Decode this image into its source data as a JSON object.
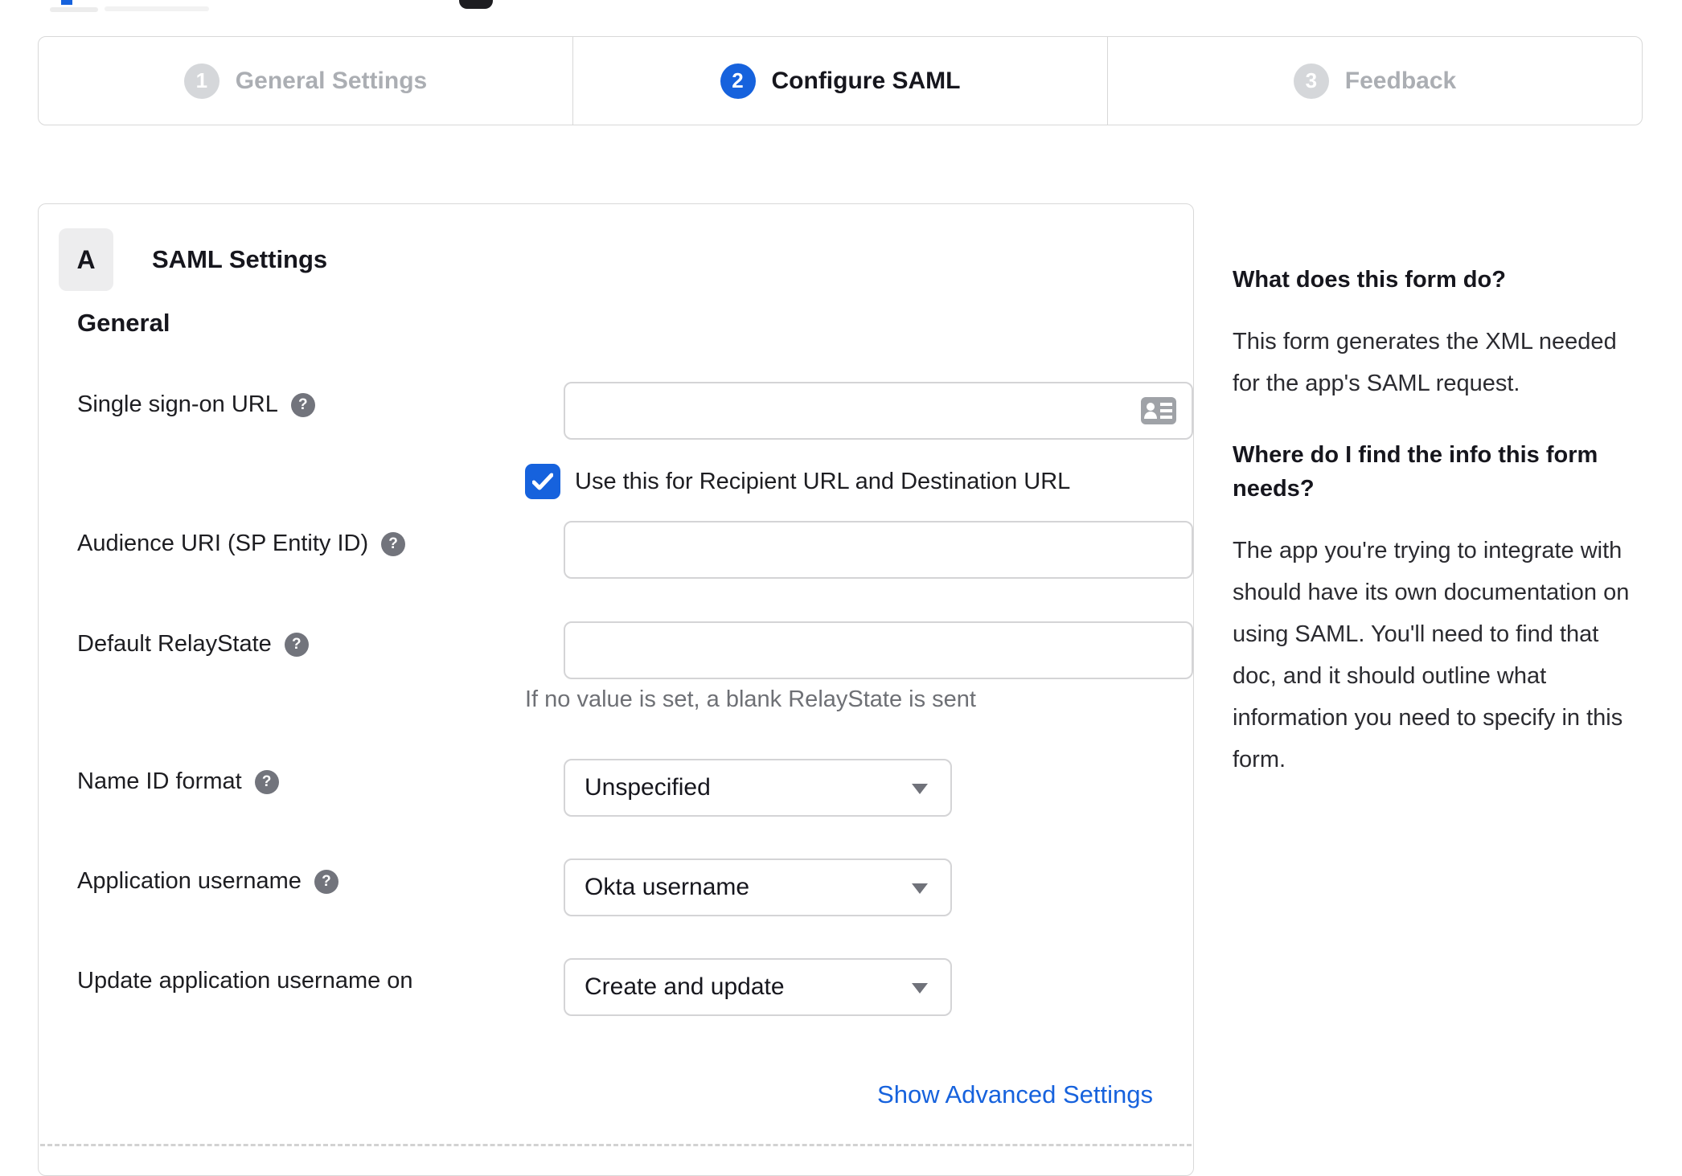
{
  "colors": {
    "accent_blue": "#1662dd",
    "inactive_grey": "#d5d7da",
    "border_grey": "#d8d8d8",
    "hint_grey": "#6e7075"
  },
  "stepper": {
    "steps": [
      {
        "number": "1",
        "label": "General Settings",
        "state": "inactive"
      },
      {
        "number": "2",
        "label": "Configure SAML",
        "state": "active"
      },
      {
        "number": "3",
        "label": "Feedback",
        "state": "inactive"
      }
    ]
  },
  "panel": {
    "section_badge": "A",
    "section_title": "SAML Settings",
    "group_heading": "General",
    "fields": [
      {
        "label": "Single sign-on URL",
        "has_help": true,
        "type": "text",
        "value": "",
        "icon": "contact-card-icon"
      },
      {
        "label": "Audience URI (SP Entity ID)",
        "has_help": true,
        "type": "text",
        "value": ""
      },
      {
        "label": "Default RelayState",
        "has_help": true,
        "type": "text",
        "value": "",
        "hint": "If no value is set, a blank RelayState is sent"
      },
      {
        "label": "Name ID format",
        "has_help": true,
        "type": "select",
        "value": "Unspecified"
      },
      {
        "label": "Application username",
        "has_help": true,
        "type": "select",
        "value": "Okta username"
      },
      {
        "label": "Update application username on",
        "has_help": false,
        "type": "select",
        "value": "Create and update"
      }
    ],
    "checkbox": {
      "checked": true,
      "label": "Use this for Recipient URL and Destination URL"
    },
    "advanced_link": "Show Advanced Settings"
  },
  "sidebar": {
    "sections": [
      {
        "heading": "What does this form do?",
        "body": "This form generates the XML needed for the app's SAML request."
      },
      {
        "heading": "Where do I find the info this form needs?",
        "body": "The app you're trying to integrate with should have its own documentation on using SAML. You'll need to find that doc, and it should outline what information you need to specify in this form."
      }
    ]
  }
}
